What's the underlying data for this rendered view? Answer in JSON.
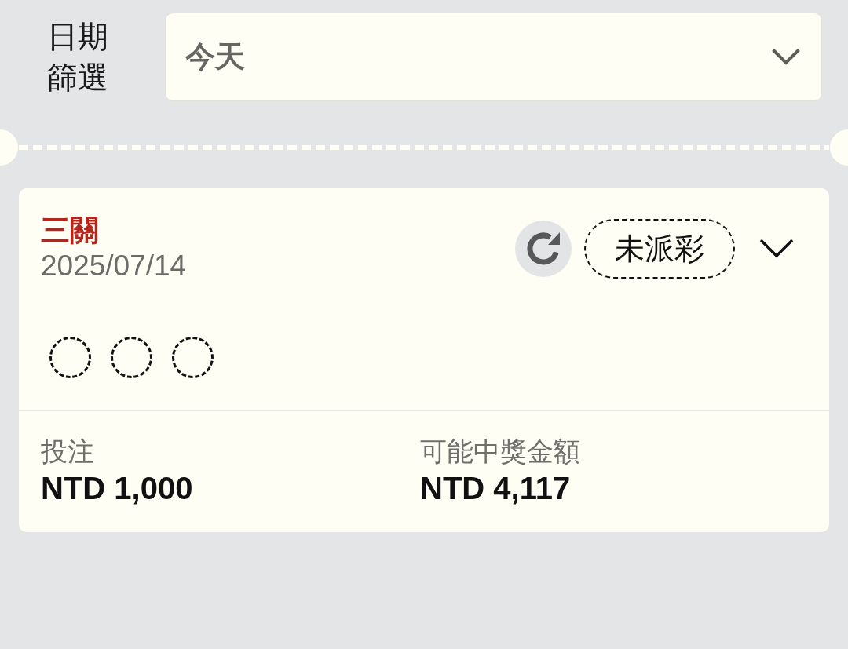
{
  "filter": {
    "label": "日期篩選",
    "value": "今天"
  },
  "bets": [
    {
      "title": "三關",
      "date": "2025/07/14",
      "status": "未派彩",
      "expanded": false,
      "balls": [
        {
          "filled": false
        },
        {
          "filled": false
        },
        {
          "filled": false
        }
      ],
      "stake": {
        "label": "投注",
        "value": "NTD 1,000"
      },
      "payout": {
        "label": "可能中獎金額",
        "value": "NTD 4,117"
      }
    }
  ]
}
